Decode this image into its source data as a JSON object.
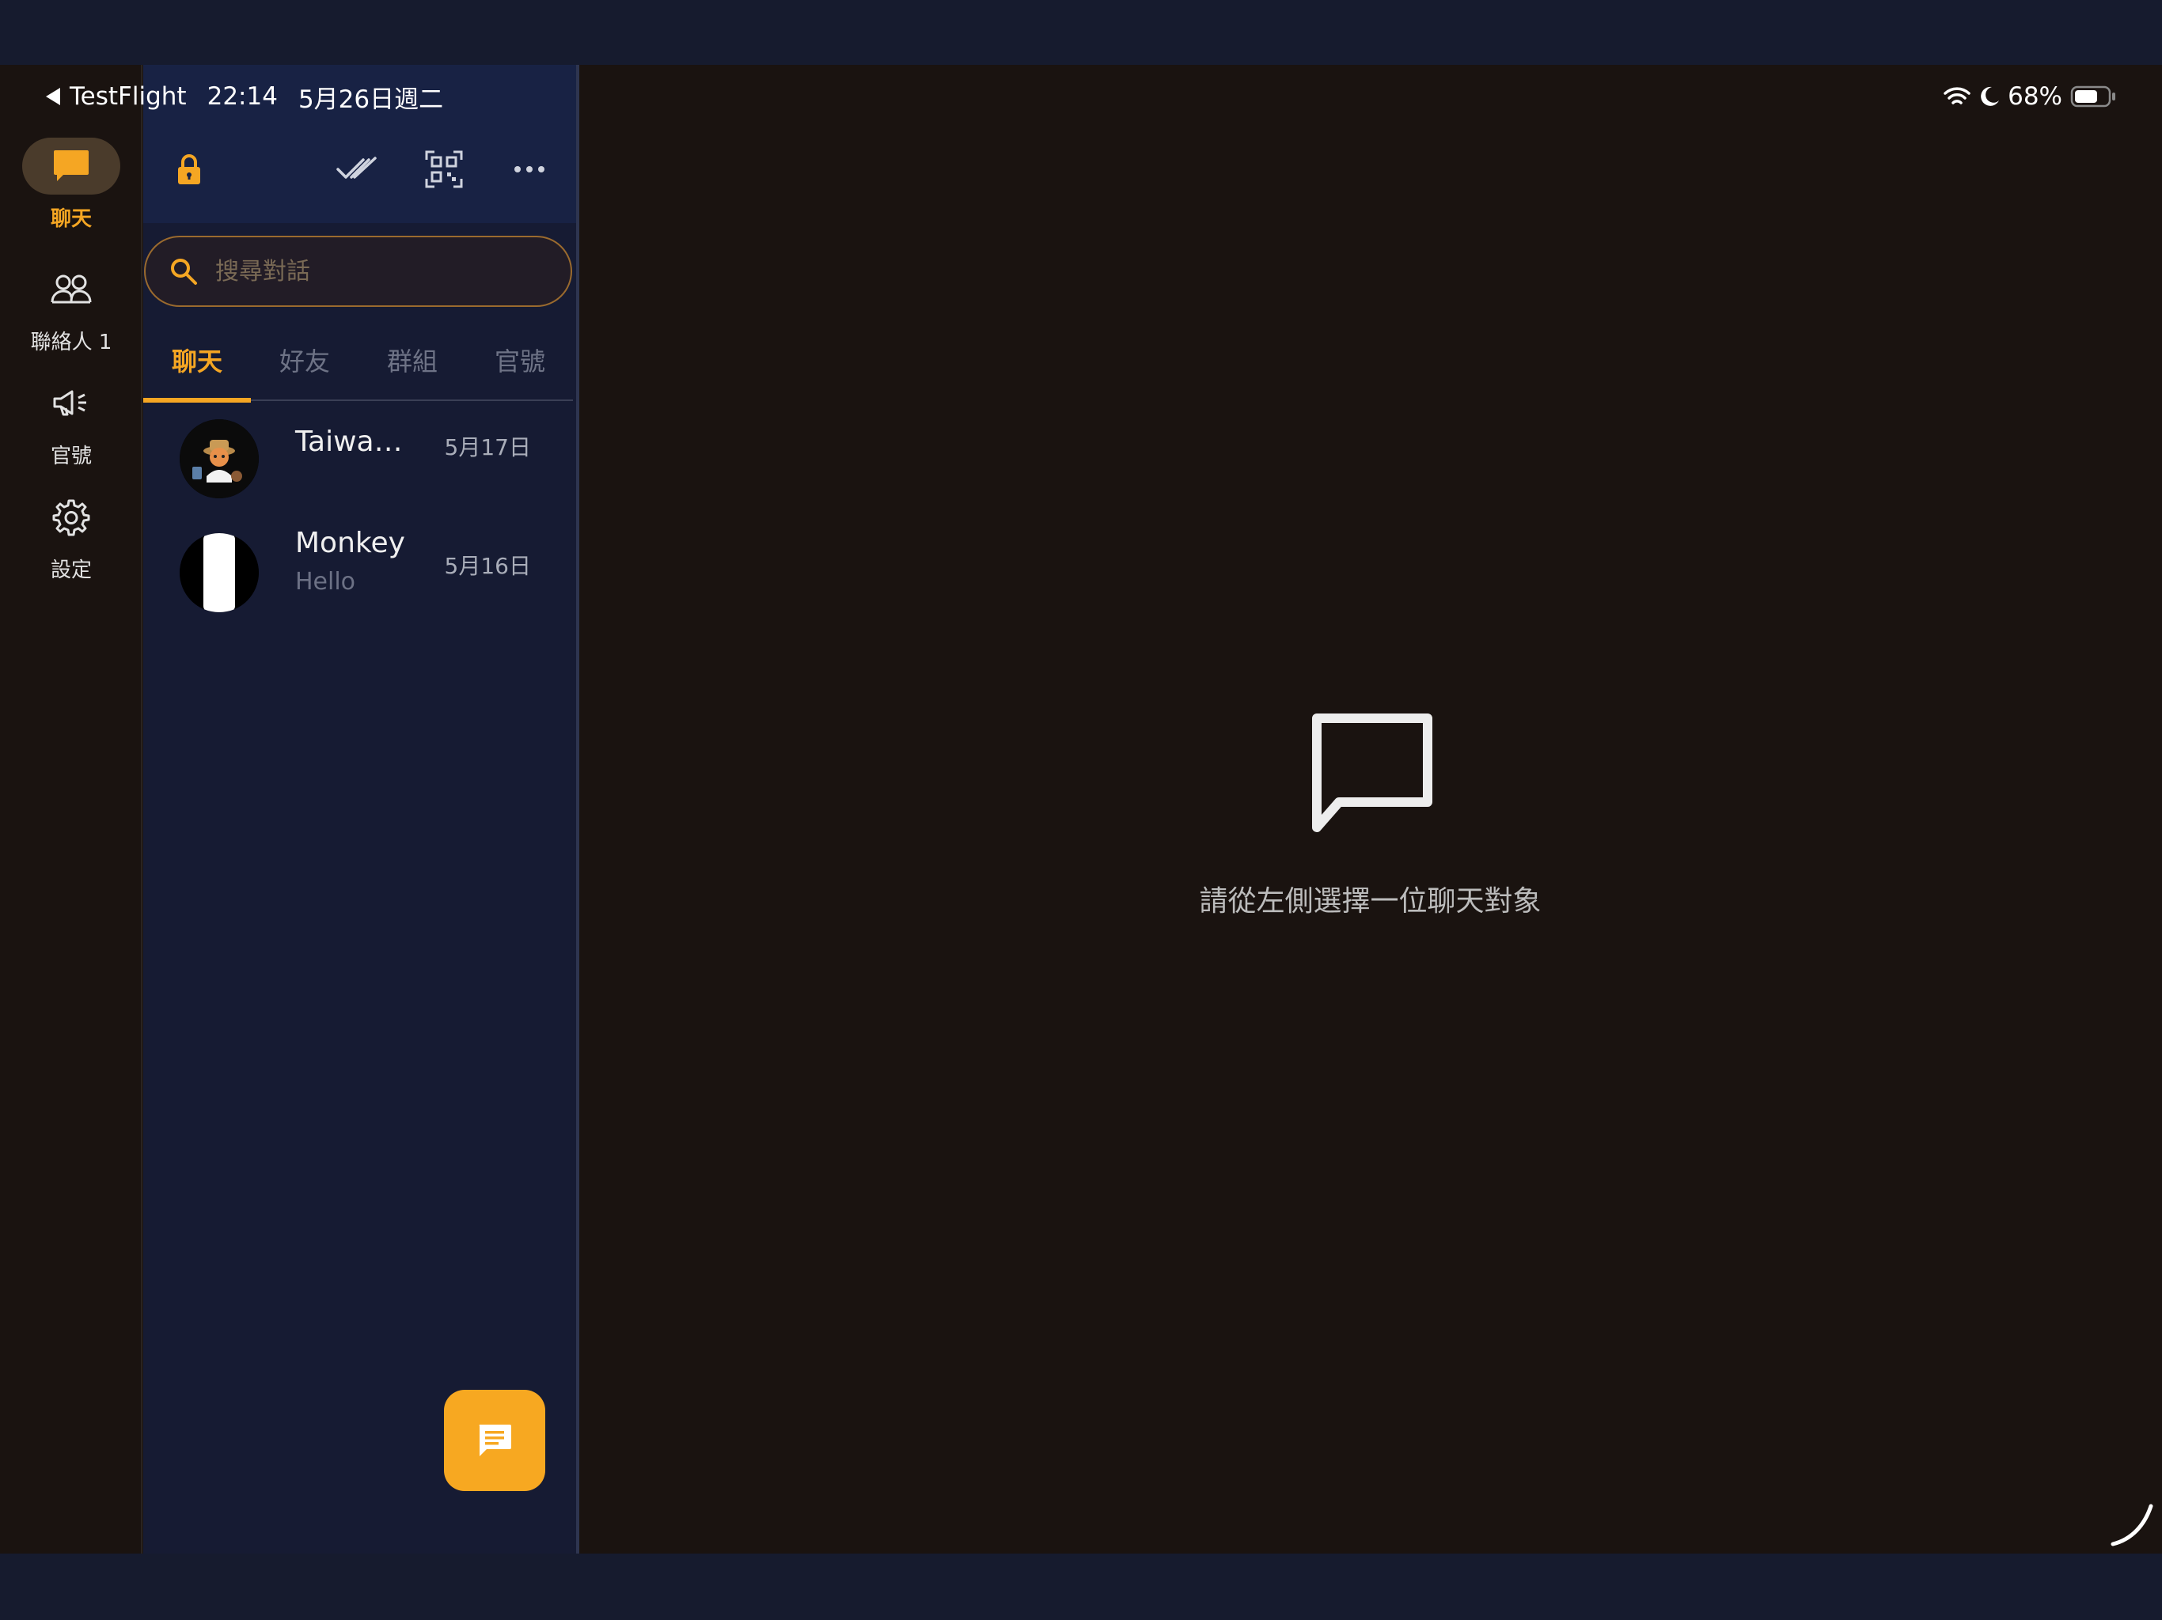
{
  "status_bar": {
    "back_app": "TestFlight",
    "time": "22:14",
    "date": "5月26日週二",
    "battery_percent": "68%",
    "icons": [
      "back-arrow-icon",
      "wifi-icon",
      "moon-icon",
      "battery-icon"
    ]
  },
  "rail": {
    "items": [
      {
        "label": "聊天",
        "icon": "chat-bubble-icon",
        "active": true
      },
      {
        "label": "聯絡人 1",
        "icon": "contacts-icon",
        "active": false
      },
      {
        "label": "官號",
        "icon": "megaphone-icon",
        "active": false
      },
      {
        "label": "設定",
        "icon": "gear-icon",
        "active": false
      }
    ]
  },
  "header": {
    "icons": [
      "lock-icon",
      "double-check-icon",
      "qr-scan-icon",
      "more-icon"
    ]
  },
  "search": {
    "placeholder": "搜尋對話",
    "value": ""
  },
  "tabs": [
    {
      "label": "聊天",
      "active": true
    },
    {
      "label": "好友",
      "active": false
    },
    {
      "label": "群組",
      "active": false
    },
    {
      "label": "官號",
      "active": false
    }
  ],
  "chats": [
    {
      "name": "Taiwa…",
      "preview": "",
      "date": "5月17日"
    },
    {
      "name": "Monkey",
      "preview": "Hello",
      "date": "5月16日"
    }
  ],
  "fab": {
    "icon": "new-message-icon"
  },
  "empty_state": {
    "icon": "chat-outline-icon",
    "text": "請從左側選擇一位聊天對象"
  },
  "colors": {
    "accent": "#f5a623",
    "panel_bg": "#161b33",
    "main_bg": "#1a1310"
  }
}
